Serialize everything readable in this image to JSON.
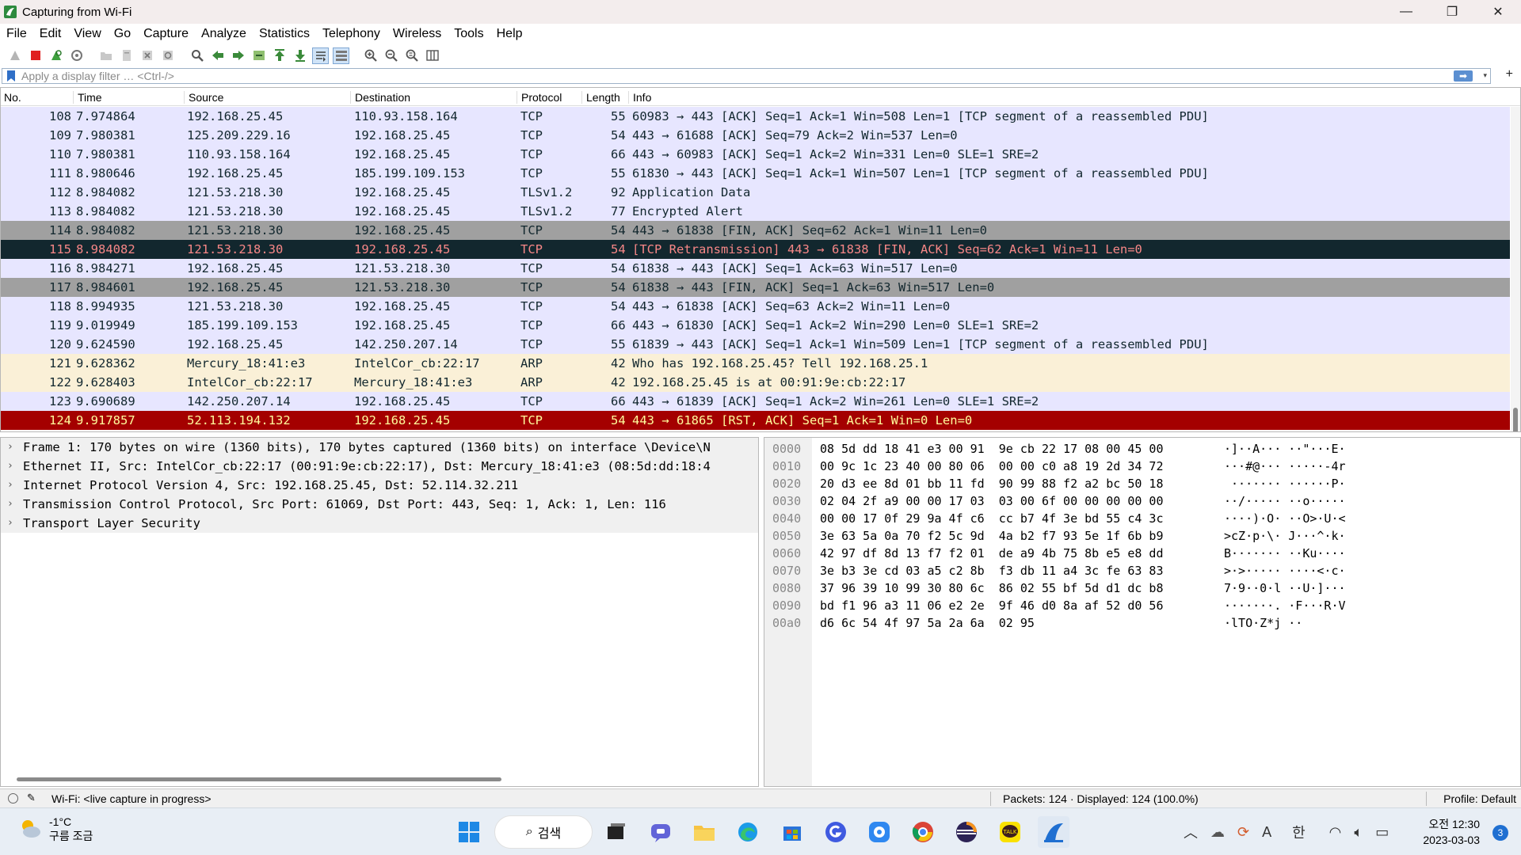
{
  "window": {
    "title": "Capturing from Wi-Fi",
    "controls": {
      "minimize": "—",
      "restore": "❐",
      "close": "✕"
    }
  },
  "menu": [
    "File",
    "Edit",
    "View",
    "Go",
    "Capture",
    "Analyze",
    "Statistics",
    "Telephony",
    "Wireless",
    "Tools",
    "Help"
  ],
  "filter": {
    "placeholder": "Apply a display filter … <Ctrl-/>",
    "apply_glyph": "➡",
    "dropdown_glyph": "▾",
    "add_glyph": "+"
  },
  "packet_list": {
    "columns": [
      "No.",
      "Time",
      "Source",
      "Destination",
      "Protocol",
      "Length",
      "Info"
    ],
    "rows": [
      {
        "no": "108",
        "time": "7.974864",
        "src": "192.168.25.45",
        "dst": "110.93.158.164",
        "proto": "TCP",
        "len": "55",
        "info": "60983 → 443 [ACK] Seq=1 Ack=1 Win=508 Len=1 [TCP segment of a reassembled PDU]",
        "style": "tcp"
      },
      {
        "no": "109",
        "time": "7.980381",
        "src": "125.209.229.16",
        "dst": "192.168.25.45",
        "proto": "TCP",
        "len": "54",
        "info": "443 → 61688 [ACK] Seq=79 Ack=2 Win=537 Len=0",
        "style": "tcp"
      },
      {
        "no": "110",
        "time": "7.980381",
        "src": "110.93.158.164",
        "dst": "192.168.25.45",
        "proto": "TCP",
        "len": "66",
        "info": "443 → 60983 [ACK] Seq=1 Ack=2 Win=331 Len=0 SLE=1 SRE=2",
        "style": "tcp"
      },
      {
        "no": "111",
        "time": "8.980646",
        "src": "192.168.25.45",
        "dst": "185.199.109.153",
        "proto": "TCP",
        "len": "55",
        "info": "61830 → 443 [ACK] Seq=1 Ack=1 Win=507 Len=1 [TCP segment of a reassembled PDU]",
        "style": "tcp"
      },
      {
        "no": "112",
        "time": "8.984082",
        "src": "121.53.218.30",
        "dst": "192.168.25.45",
        "proto": "TLSv1.2",
        "len": "92",
        "info": "Application Data",
        "style": "tcp"
      },
      {
        "no": "113",
        "time": "8.984082",
        "src": "121.53.218.30",
        "dst": "192.168.25.45",
        "proto": "TLSv1.2",
        "len": "77",
        "info": "Encrypted Alert",
        "style": "tcp"
      },
      {
        "no": "114",
        "time": "8.984082",
        "src": "121.53.218.30",
        "dst": "192.168.25.45",
        "proto": "TCP",
        "len": "54",
        "info": "443 → 61838 [FIN, ACK] Seq=62 Ack=1 Win=11 Len=0",
        "style": "fin"
      },
      {
        "no": "115",
        "time": "8.984082",
        "src": "121.53.218.30",
        "dst": "192.168.25.45",
        "proto": "TCP",
        "len": "54",
        "info": "[TCP Retransmission] 443 → 61838 [FIN, ACK] Seq=62 Ack=1 Win=11 Len=0",
        "style": "bad"
      },
      {
        "no": "116",
        "time": "8.984271",
        "src": "192.168.25.45",
        "dst": "121.53.218.30",
        "proto": "TCP",
        "len": "54",
        "info": "61838 → 443 [ACK] Seq=1 Ack=63 Win=517 Len=0",
        "style": "tcp"
      },
      {
        "no": "117",
        "time": "8.984601",
        "src": "192.168.25.45",
        "dst": "121.53.218.30",
        "proto": "TCP",
        "len": "54",
        "info": "61838 → 443 [FIN, ACK] Seq=1 Ack=63 Win=517 Len=0",
        "style": "fin"
      },
      {
        "no": "118",
        "time": "8.994935",
        "src": "121.53.218.30",
        "dst": "192.168.25.45",
        "proto": "TCP",
        "len": "54",
        "info": "443 → 61838 [ACK] Seq=63 Ack=2 Win=11 Len=0",
        "style": "tcp"
      },
      {
        "no": "119",
        "time": "9.019949",
        "src": "185.199.109.153",
        "dst": "192.168.25.45",
        "proto": "TCP",
        "len": "66",
        "info": "443 → 61830 [ACK] Seq=1 Ack=2 Win=290 Len=0 SLE=1 SRE=2",
        "style": "tcp"
      },
      {
        "no": "120",
        "time": "9.624590",
        "src": "192.168.25.45",
        "dst": "142.250.207.14",
        "proto": "TCP",
        "len": "55",
        "info": "61839 → 443 [ACK] Seq=1 Ack=1 Win=509 Len=1 [TCP segment of a reassembled PDU]",
        "style": "tcp"
      },
      {
        "no": "121",
        "time": "9.628362",
        "src": "Mercury_18:41:e3",
        "dst": "IntelCor_cb:22:17",
        "proto": "ARP",
        "len": "42",
        "info": "Who has 192.168.25.45? Tell 192.168.25.1",
        "style": "arp"
      },
      {
        "no": "122",
        "time": "9.628403",
        "src": "IntelCor_cb:22:17",
        "dst": "Mercury_18:41:e3",
        "proto": "ARP",
        "len": "42",
        "info": "192.168.25.45 is at 00:91:9e:cb:22:17",
        "style": "arp"
      },
      {
        "no": "123",
        "time": "9.690689",
        "src": "142.250.207.14",
        "dst": "192.168.25.45",
        "proto": "TCP",
        "len": "66",
        "info": "443 → 61839 [ACK] Seq=1 Ack=2 Win=261 Len=0 SLE=1 SRE=2",
        "style": "tcp"
      },
      {
        "no": "124",
        "time": "9.917857",
        "src": "52.113.194.132",
        "dst": "192.168.25.45",
        "proto": "TCP",
        "len": "54",
        "info": "443 → 61865 [RST, ACK] Seq=1 Ack=1 Win=0 Len=0",
        "style": "rst"
      }
    ]
  },
  "row_styles": {
    "tcp": {
      "bg": "#e7e6ff",
      "fg": "#12272e"
    },
    "fin": {
      "bg": "#a0a0a0",
      "fg": "#12272e"
    },
    "bad": {
      "bg": "#12272e",
      "fg": "#f78787"
    },
    "arp": {
      "bg": "#faf0d7",
      "fg": "#12272e"
    },
    "rst": {
      "bg": "#a40000",
      "fg": "#fffc9c"
    }
  },
  "detail": {
    "rows": [
      "Frame 1: 170 bytes on wire (1360 bits), 170 bytes captured (1360 bits) on interface \\Device\\N",
      "Ethernet II, Src: IntelCor_cb:22:17 (00:91:9e:cb:22:17), Dst: Mercury_18:41:e3 (08:5d:dd:18:4",
      "Internet Protocol Version 4, Src: 192.168.25.45, Dst: 52.114.32.211",
      "Transmission Control Protocol, Src Port: 61069, Dst Port: 443, Seq: 1, Ack: 1, Len: 116",
      "Transport Layer Security"
    ],
    "expander": "›"
  },
  "bytes": {
    "rows": [
      {
        "offset": "0000",
        "hex": "08 5d dd 18 41 e3 00 91  9e cb 22 17 08 00 45 00",
        "ascii": "·]··A··· ··\"···E·"
      },
      {
        "offset": "0010",
        "hex": "00 9c 1c 23 40 00 80 06  00 00 c0 a8 19 2d 34 72",
        "ascii": "···#@··· ·····-4r"
      },
      {
        "offset": "0020",
        "hex": "20 d3 ee 8d 01 bb 11 fd  90 99 88 f2 a2 bc 50 18",
        "ascii": " ······· ······P·"
      },
      {
        "offset": "0030",
        "hex": "02 04 2f a9 00 00 17 03  03 00 6f 00 00 00 00 00",
        "ascii": "··/····· ··o·····"
      },
      {
        "offset": "0040",
        "hex": "00 00 17 0f 29 9a 4f c6  cc b7 4f 3e bd 55 c4 3c",
        "ascii": "····)·O· ··O>·U·<"
      },
      {
        "offset": "0050",
        "hex": "3e 63 5a 0a 70 f2 5c 9d  4a b2 f7 93 5e 1f 6b b9",
        "ascii": ">cZ·p·\\· J···^·k·"
      },
      {
        "offset": "0060",
        "hex": "42 97 df 8d 13 f7 f2 01  de a9 4b 75 8b e5 e8 dd",
        "ascii": "B······· ··Ku····"
      },
      {
        "offset": "0070",
        "hex": "3e b3 3e cd 03 a5 c2 8b  f3 db 11 a4 3c fe 63 83",
        "ascii": ">·>····· ····<·c·"
      },
      {
        "offset": "0080",
        "hex": "37 96 39 10 99 30 80 6c  86 02 55 bf 5d d1 dc b8",
        "ascii": "7·9··0·l ··U·]···"
      },
      {
        "offset": "0090",
        "hex": "bd f1 96 a3 11 06 e2 2e  9f 46 d0 8a af 52 d0 56",
        "ascii": "·······. ·F···R·V"
      },
      {
        "offset": "00a0",
        "hex": "d6 6c 54 4f 97 5a 2a 6a  02 95",
        "ascii": "·lTO·Z*j ··"
      }
    ]
  },
  "status": {
    "interface": "Wi-Fi: <live capture in progress>",
    "packets": "Packets: 124 · Displayed: 124 (100.0%)",
    "profile": "Profile: Default"
  },
  "taskbar": {
    "weather_temp": "-1°C",
    "weather_desc": "구름 조금",
    "search_label": "검색",
    "ime_a": "A",
    "ime_lang": "한",
    "clock_time": "오전 12:30",
    "clock_date": "2023-03-03",
    "notification_count": "3"
  }
}
